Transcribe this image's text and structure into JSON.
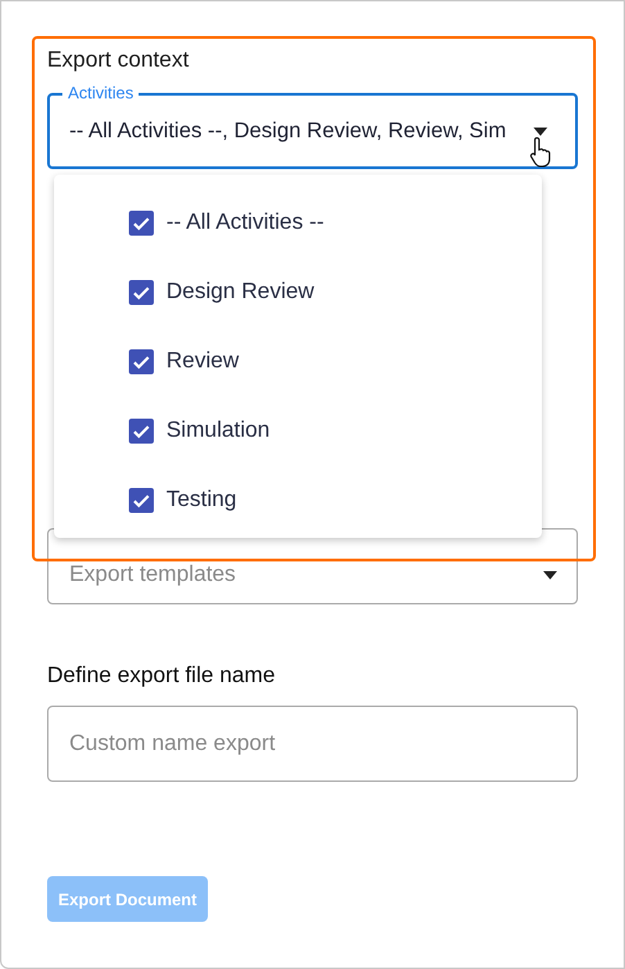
{
  "context_section": {
    "title": "Export context",
    "activities_field": {
      "label": "Activities",
      "value": "-- All Activities --, Design Review, Review, Sim",
      "expanded": true
    }
  },
  "activities_menu": {
    "items": [
      {
        "label": "-- All Activities --",
        "checked": true
      },
      {
        "label": "Design Review",
        "checked": true
      },
      {
        "label": "Review",
        "checked": true
      },
      {
        "label": "Simulation",
        "checked": true
      },
      {
        "label": "Testing",
        "checked": true
      }
    ]
  },
  "templates_field": {
    "placeholder": "Export templates"
  },
  "file_name": {
    "title": "Define export file name",
    "placeholder": "Custom name export"
  },
  "export_button": {
    "label": "Export Document",
    "disabled": true
  }
}
